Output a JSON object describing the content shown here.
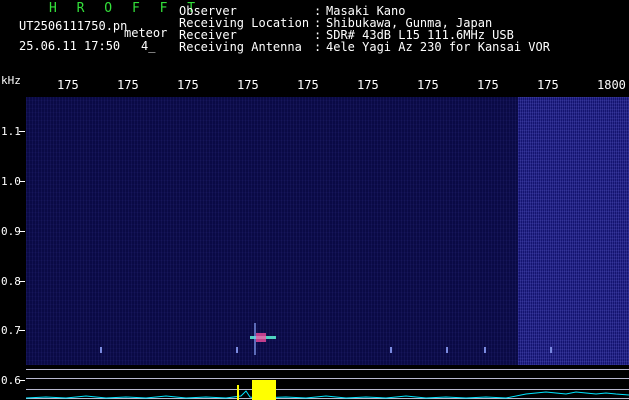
{
  "header": {
    "logo": "H R O F F T",
    "filename": "UT2506111750.pn",
    "tag": "meteor",
    "datetime": "25.06.11 17:50",
    "count": "4_",
    "info": [
      {
        "label": "Observer",
        "value": "Masaki Kano"
      },
      {
        "label": "Receiving Location",
        "value": "Shibukawa, Gunma, Japan"
      },
      {
        "label": "Receiver",
        "value": "SDR# 43dB L15 111.6MHz USB"
      },
      {
        "label": "Receiving Antenna",
        "value": "4ele Yagi Az 230 for Kansai VOR"
      }
    ],
    "colon": ":"
  },
  "axis": {
    "y_unit": "kHz",
    "x_ticks": [
      "175",
      "175",
      "175",
      "175",
      "175",
      "175",
      "175",
      "175",
      "175",
      "1800"
    ],
    "y_ticks": [
      "1.1",
      "1.0",
      "0.9",
      "0.8",
      "0.7",
      "0.6"
    ]
  },
  "colors": {
    "background": "#000000",
    "plot": "#0a0a45",
    "logo": "#33e03a",
    "spectrum": "#00e5ff",
    "peak": "#ffff00"
  }
}
